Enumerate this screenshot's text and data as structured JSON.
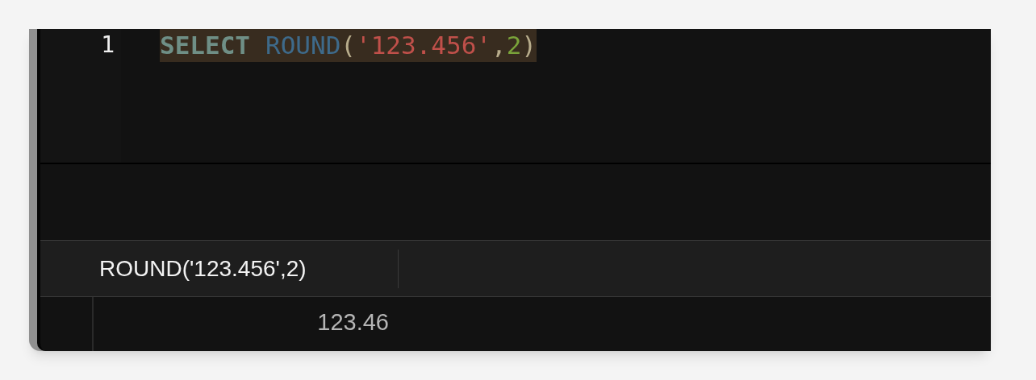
{
  "editor": {
    "lines": [
      {
        "number": "1",
        "highlighted": true,
        "tokens": [
          {
            "kind": "keyword",
            "text": "SELECT"
          },
          {
            "kind": "function",
            "text": "ROUND"
          },
          {
            "kind": "punct",
            "text": "("
          },
          {
            "kind": "string",
            "text": "'123.456'"
          },
          {
            "kind": "punct",
            "text": ","
          },
          {
            "kind": "number",
            "text": "2"
          },
          {
            "kind": "punct",
            "text": ")"
          }
        ]
      }
    ]
  },
  "results": {
    "columns": [
      "ROUND('123.456',2)"
    ],
    "rows": [
      [
        "123.46"
      ]
    ]
  }
}
